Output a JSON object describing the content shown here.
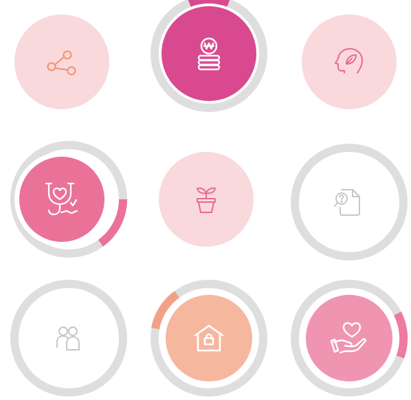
{
  "colors": {
    "track": "#dedede",
    "light_pink": "#f9d9dc",
    "magenta": "#d9498f",
    "pink": "#ea7299",
    "peach": "#f6b79f",
    "peach_arc": "#f2a087",
    "rose": "#ef95b1",
    "rose_arc": "#ef7aa0",
    "icon_orange": "#f2916c",
    "icon_pink": "#e86a8e",
    "icon_gray": "#c7c7c7",
    "white": "#ffffff"
  },
  "tiles": [
    {
      "icon": "share-icon",
      "ring": false,
      "progress": 0
    },
    {
      "icon": "won-coins-icon",
      "ring": true,
      "progress": 0.12
    },
    {
      "icon": "head-leaf-icon",
      "ring": false,
      "progress": 0
    },
    {
      "icon": "stethoscope-heart-icon",
      "ring": true,
      "progress": 0.12
    },
    {
      "icon": "sprout-pot-icon",
      "ring": false,
      "progress": 0
    },
    {
      "icon": "document-question-icon",
      "ring": true,
      "progress": 0
    },
    {
      "icon": "people-icon",
      "ring": true,
      "progress": 0
    },
    {
      "icon": "house-lock-icon",
      "ring": true,
      "progress": 0.08
    },
    {
      "icon": "hand-heart-icon",
      "ring": true,
      "progress": 0.12
    }
  ]
}
